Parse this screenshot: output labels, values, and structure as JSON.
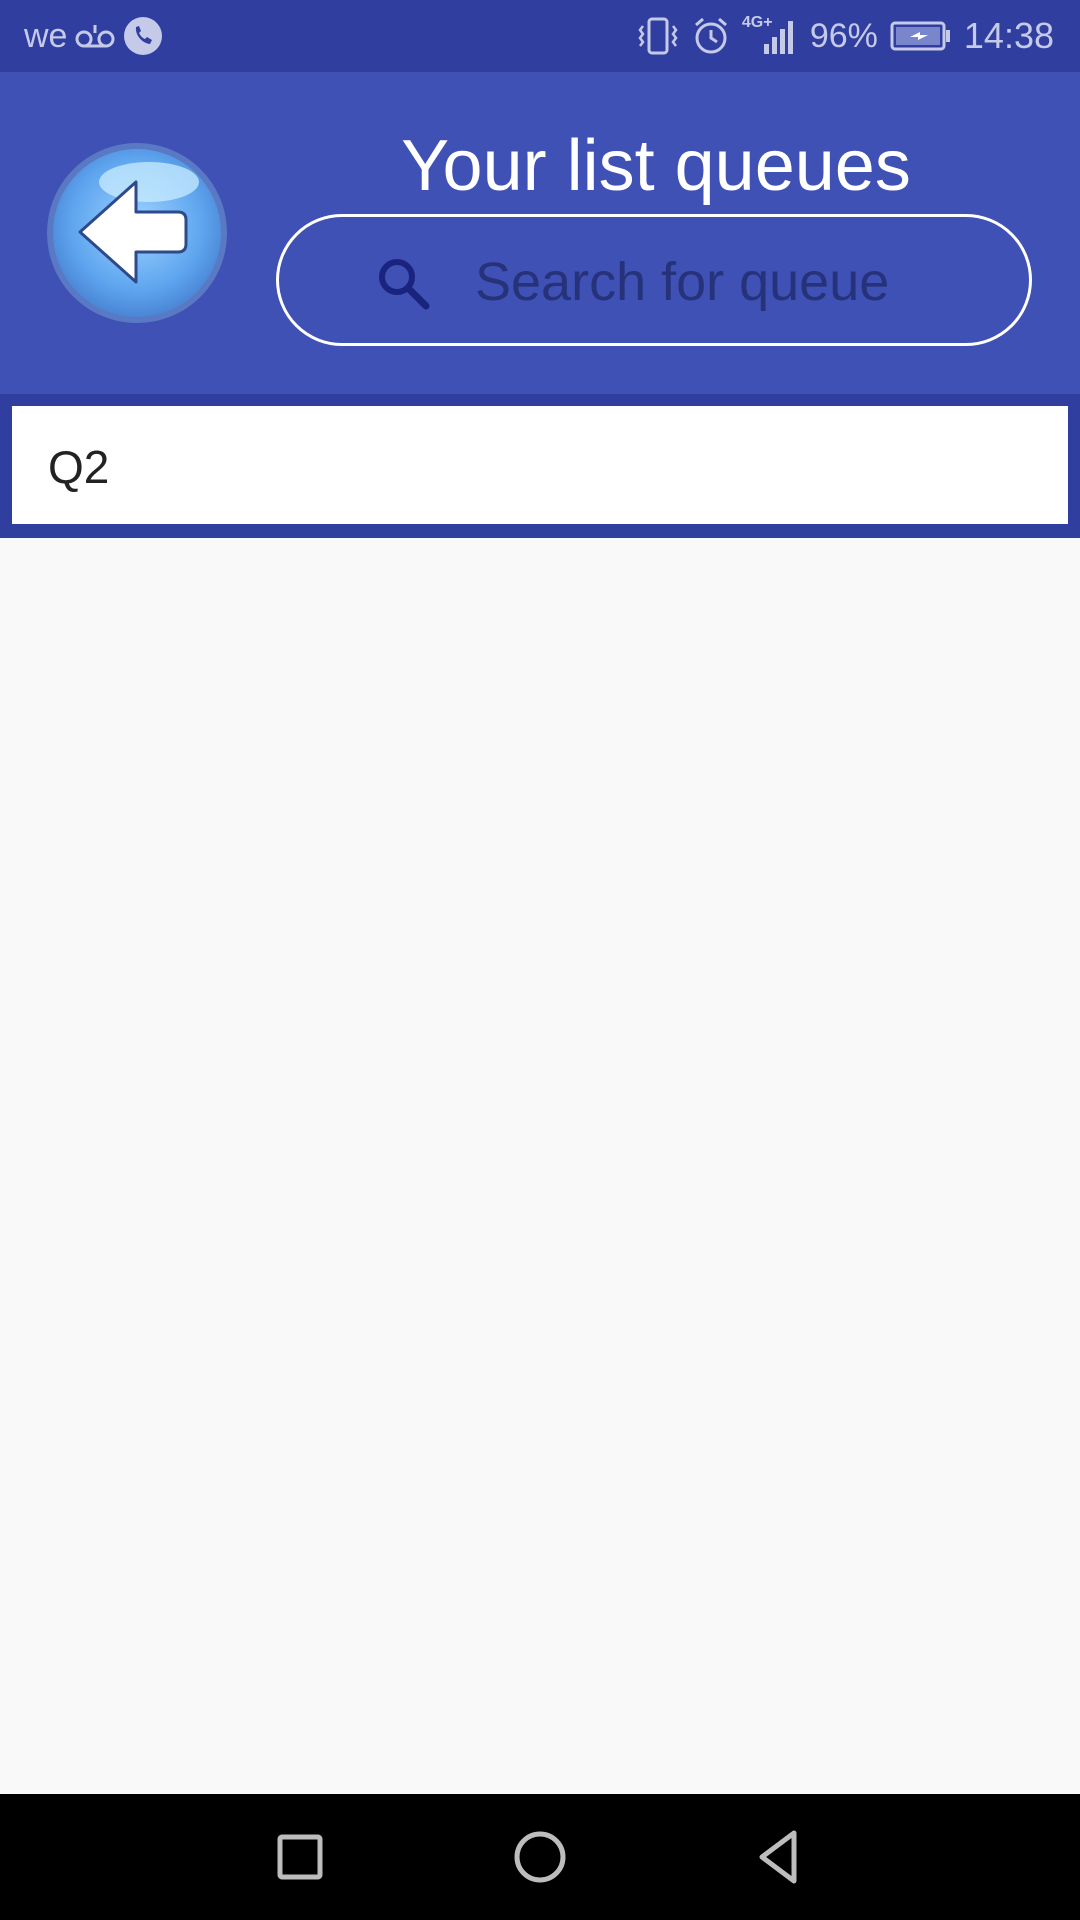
{
  "status_bar": {
    "carrier": "we",
    "battery_percent": "96%",
    "time": "14:38",
    "network_label": "4G+",
    "icons": [
      "voicemail-icon",
      "phone-icon",
      "vibrate-icon",
      "alarm-icon",
      "signal-icon",
      "battery-charging-icon"
    ]
  },
  "header": {
    "title": "Your list queues",
    "search_placeholder": "Search for queue",
    "search_value": ""
  },
  "queues": [
    {
      "label": "Q2"
    }
  ],
  "nav_bar": {
    "buttons": [
      "recent-apps-icon",
      "home-icon",
      "back-triangle-icon"
    ]
  },
  "colors": {
    "status_bar": "#303f9f",
    "header": "#3f51b5",
    "background": "#f9f9f9",
    "nav_bar": "#000000"
  }
}
